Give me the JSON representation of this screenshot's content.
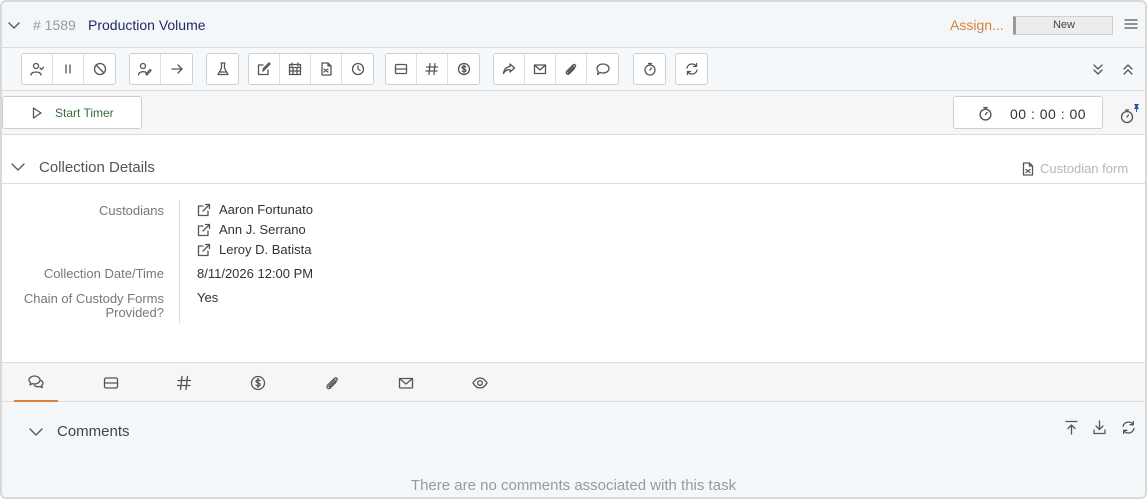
{
  "header": {
    "task_id": "# 1589",
    "title": "Production Volume",
    "assign_label": "Assign...",
    "status": "New"
  },
  "toolbar": {
    "groups": [
      [
        "assign-user-icon",
        "pause-icon",
        "cancel-icon"
      ],
      [
        "edit-user-icon",
        "arrow-right-icon"
      ],
      [
        "flask-icon"
      ],
      [
        "edit-icon",
        "calendar-icon",
        "document-icon",
        "clock-icon"
      ],
      [
        "card-icon",
        "hash-icon",
        "dollar-icon"
      ],
      [
        "share-icon",
        "mail-icon",
        "paperclip-icon",
        "comment-icon"
      ],
      [
        "stopwatch-icon"
      ],
      [
        "refresh-icon"
      ]
    ]
  },
  "timer": {
    "start_label": "Start Timer",
    "value": "00 : 00 : 00"
  },
  "collection": {
    "title": "Collection Details",
    "custodian_form_label": "Custodian form",
    "labels": {
      "custodians": "Custodians",
      "date": "Collection Date/Time",
      "chain_line1": "Chain of Custody Forms",
      "chain_line2": "Provided?"
    },
    "custodians": [
      "Aaron Fortunato",
      "Ann J. Serrano",
      "Leroy D. Batista"
    ],
    "date": "8/11/2026 12:00 PM",
    "chain": "Yes"
  },
  "tabs": [
    "comments-icon",
    "card-icon",
    "hash-icon",
    "dollar-icon",
    "paperclip-icon",
    "mail-icon",
    "eye-icon"
  ],
  "comments": {
    "title": "Comments",
    "empty": "There are no comments associated with this task"
  },
  "colors": {
    "accent": "#d9823b",
    "title": "#1f2a5c",
    "timer_text": "#3a6b3a"
  }
}
